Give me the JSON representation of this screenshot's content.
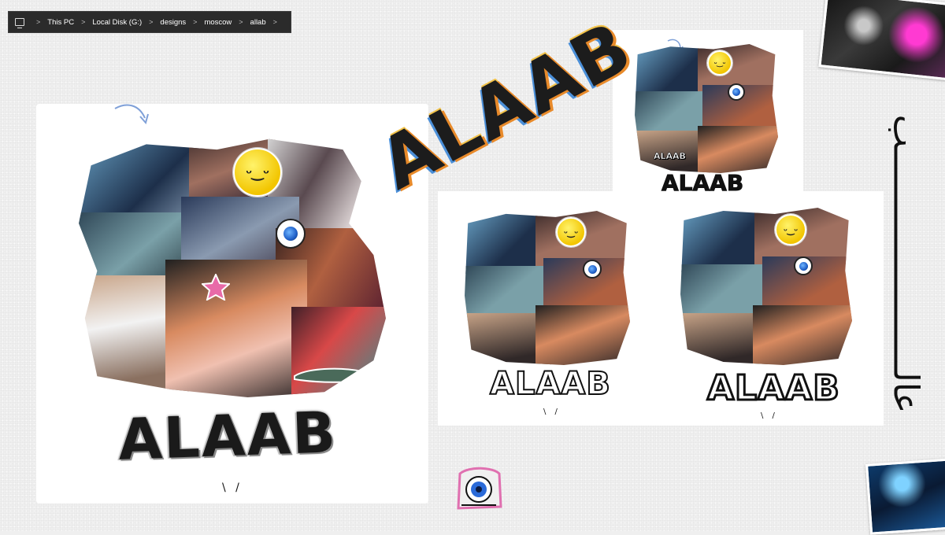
{
  "breadcrumb": {
    "icon": "computer-icon",
    "items": [
      "This PC",
      "Local Disk (G:)",
      "designs",
      "moscow",
      "allab"
    ],
    "separator": ">"
  },
  "design": {
    "main_title": "ALAAB",
    "big_title": "ALAAB",
    "variant_1_title": "ALAAB",
    "variant_2_title": "ALAAB",
    "top_thumb_title": "ALAAB",
    "arabic_title": "عالــــــــــــــــــــــب",
    "caption_chevrons": "\\ /",
    "small_label": "ALAAB"
  },
  "colors": {
    "breadcrumb_bg": "#2b2b2b",
    "page_bg": "#efefef",
    "board_bg": "#ffffff",
    "smiley": "#f2c500",
    "eye_iris": "#1f5fc8",
    "arrow": "#7fa0d8"
  }
}
